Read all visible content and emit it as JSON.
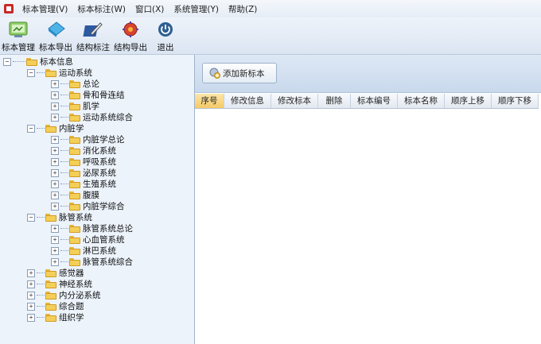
{
  "menubar": {
    "items": [
      "标本管理(V)",
      "标本标注(W)",
      "窗口(X)",
      "系统管理(Y)",
      "帮助(Z)"
    ]
  },
  "toolbar": {
    "buttons": [
      {
        "label": "标本管理",
        "icon": "specimen-manage-icon"
      },
      {
        "label": "标本导出",
        "icon": "specimen-export-icon"
      },
      {
        "label": "结构标注",
        "icon": "structure-annotate-icon"
      },
      {
        "label": "结构导出",
        "icon": "structure-export-icon"
      },
      {
        "label": "退出",
        "icon": "power-icon"
      }
    ]
  },
  "tree": {
    "root": "标本信息",
    "groups": [
      {
        "label": "运动系统",
        "children": [
          "总论",
          "骨和骨连结",
          "肌学",
          "运动系统综合"
        ]
      },
      {
        "label": "内脏学",
        "children": [
          "内脏学总论",
          "消化系统",
          "呼吸系统",
          "泌尿系统",
          "生殖系统",
          "腹膜",
          "内脏学综合"
        ]
      },
      {
        "label": "脉管系统",
        "children": [
          "脉管系统总论",
          "心血管系统",
          "淋巴系统",
          "脉管系统综合"
        ]
      },
      {
        "label": "感觉器",
        "children": []
      },
      {
        "label": "神经系统",
        "children": []
      },
      {
        "label": "内分泌系统",
        "children": []
      },
      {
        "label": "综合题",
        "children": []
      },
      {
        "label": "组织学",
        "children": []
      }
    ]
  },
  "content": {
    "add_button": "添加新标本",
    "columns": [
      "序号",
      "修改信息",
      "修改标本",
      "删除",
      "标本编号",
      "标本名称",
      "顺序上移",
      "顺序下移"
    ]
  },
  "colors": {
    "accent": "#f5c965",
    "panel": "#ecf3fb",
    "folder": "#f4cf58"
  }
}
